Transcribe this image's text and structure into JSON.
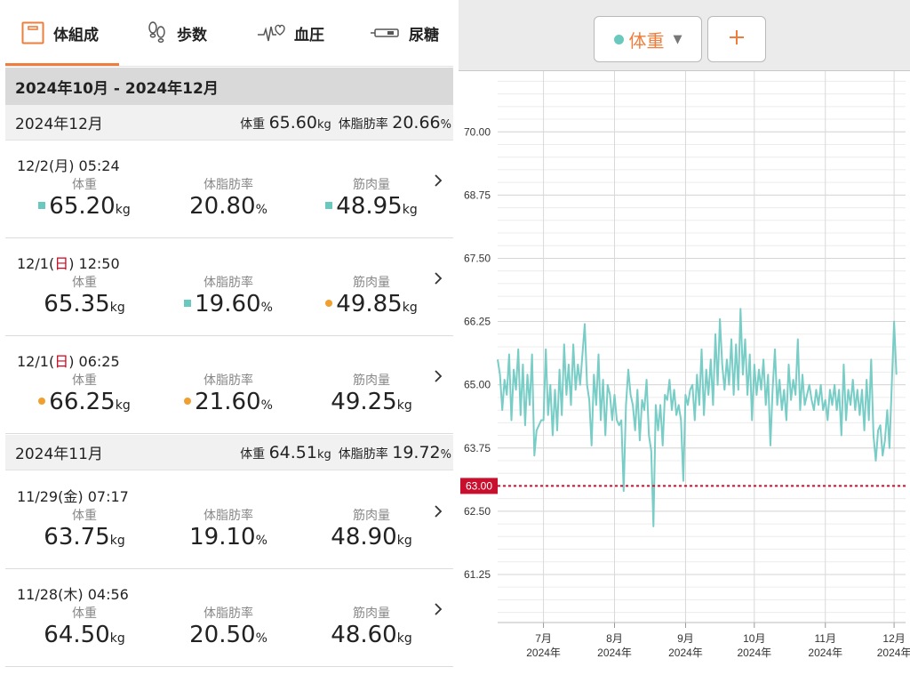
{
  "tabs": [
    {
      "label": "体組成",
      "icon": "body-composition-icon",
      "active": true
    },
    {
      "label": "歩数",
      "icon": "footsteps-icon",
      "active": false
    },
    {
      "label": "血圧",
      "icon": "heart-pulse-icon",
      "active": false
    },
    {
      "label": "尿糖",
      "icon": "urine-glucose-icon",
      "active": false
    }
  ],
  "range_label": "2024年10月 - 2024年12月",
  "months": [
    {
      "name": "2024年12月",
      "weight_label": "体重",
      "weight": "65.60",
      "weight_unit": "kg",
      "fat_label": "体脂肪率",
      "fat": "20.66",
      "fat_unit": "%"
    },
    {
      "name": "2024年11月",
      "weight_label": "体重",
      "weight": "64.51",
      "weight_unit": "kg",
      "fat_label": "体脂肪率",
      "fat": "19.72",
      "fat_unit": "%"
    }
  ],
  "entries": [
    {
      "date": "12/2",
      "weekday": "月",
      "is_sunday": false,
      "time": "05:24",
      "weight": "65.20",
      "weight_marker": "square",
      "fat": "20.80",
      "fat_marker": "none",
      "muscle": "48.95",
      "muscle_marker": "square"
    },
    {
      "date": "12/1",
      "weekday": "日",
      "is_sunday": true,
      "time": "12:50",
      "weight": "65.35",
      "weight_marker": "none",
      "fat": "19.60",
      "fat_marker": "square",
      "muscle": "49.85",
      "muscle_marker": "dot"
    },
    {
      "date": "12/1",
      "weekday": "日",
      "is_sunday": true,
      "time": "06:25",
      "weight": "66.25",
      "weight_marker": "dot",
      "fat": "21.60",
      "fat_marker": "dot",
      "muscle": "49.25",
      "muscle_marker": "none"
    },
    {
      "date": "11/29",
      "weekday": "金",
      "is_sunday": false,
      "time": "07:17",
      "weight": "63.75",
      "weight_marker": "none",
      "fat": "19.10",
      "fat_marker": "none",
      "muscle": "48.90",
      "muscle_marker": "none"
    },
    {
      "date": "11/28",
      "weekday": "木",
      "is_sunday": false,
      "time": "04:56",
      "weight": "64.50",
      "weight_marker": "none",
      "fat": "20.50",
      "fat_marker": "none",
      "muscle": "48.60",
      "muscle_marker": "none"
    }
  ],
  "labels": {
    "weight": "体重",
    "fat": "体脂肪率",
    "muscle": "筋肉量",
    "kg": "kg",
    "pct": "%"
  },
  "colors": {
    "accent": "#ef7d3c",
    "series": "#78cdc6",
    "target_line": "#c8102e",
    "sunday": "#d0021b",
    "marker_square": "#6ac9be",
    "marker_dot": "#f0a030"
  },
  "chart_selector": {
    "label": "体重",
    "caret": "▼",
    "add_icon": "plus-icon"
  },
  "chart_data": {
    "type": "line",
    "ylabel": "",
    "ylim": [
      60.3,
      71.2
    ],
    "yticks": [
      "70.00",
      "68.75",
      "67.50",
      "66.25",
      "65.00",
      "63.75",
      "62.50",
      "61.25"
    ],
    "target": {
      "value": 63.0,
      "label": "63.00"
    },
    "xticks": [
      {
        "month": "7月",
        "year": "2024年",
        "x": "2024-07-01"
      },
      {
        "month": "8月",
        "year": "2024年",
        "x": "2024-08-01"
      },
      {
        "month": "9月",
        "year": "2024年",
        "x": "2024-09-01"
      },
      {
        "month": "10月",
        "year": "2024年",
        "x": "2024-10-01"
      },
      {
        "month": "11月",
        "year": "2024年",
        "x": "2024-11-01"
      },
      {
        "month": "12月",
        "year": "2024年",
        "x": "2024-12-01"
      }
    ],
    "xlim": [
      "2024-06-11",
      "2024-12-06"
    ],
    "grid": true,
    "series": [
      {
        "name": "体重",
        "points": [
          [
            "2024-06-11",
            65.5
          ],
          [
            "2024-06-12",
            65.2
          ],
          [
            "2024-06-13",
            64.5
          ],
          [
            "2024-06-14",
            65.1
          ],
          [
            "2024-06-15",
            64.8
          ],
          [
            "2024-06-16",
            65.6
          ],
          [
            "2024-06-17",
            64.3
          ],
          [
            "2024-06-18",
            65.3
          ],
          [
            "2024-06-19",
            64.9
          ],
          [
            "2024-06-20",
            65.7
          ],
          [
            "2024-06-21",
            64.4
          ],
          [
            "2024-06-22",
            65.4
          ],
          [
            "2024-06-23",
            64.2
          ],
          [
            "2024-06-24",
            65.2
          ],
          [
            "2024-06-25",
            64.6
          ],
          [
            "2024-06-26",
            65.6
          ],
          [
            "2024-06-27",
            63.6
          ],
          [
            "2024-06-28",
            64.1
          ],
          [
            "2024-06-29",
            64.2
          ],
          [
            "2024-06-30",
            64.3
          ],
          [
            "2024-07-01",
            64.3
          ],
          [
            "2024-07-02",
            65.7
          ],
          [
            "2024-07-03",
            64.4
          ],
          [
            "2024-07-04",
            65.0
          ],
          [
            "2024-07-05",
            64.0
          ],
          [
            "2024-07-06",
            64.9
          ],
          [
            "2024-07-07",
            64.1
          ],
          [
            "2024-07-08",
            65.3
          ],
          [
            "2024-07-09",
            64.4
          ],
          [
            "2024-07-10",
            65.8
          ],
          [
            "2024-07-11",
            64.8
          ],
          [
            "2024-07-12",
            65.4
          ],
          [
            "2024-07-13",
            64.6
          ],
          [
            "2024-07-14",
            65.8
          ],
          [
            "2024-07-15",
            64.9
          ],
          [
            "2024-07-16",
            65.4
          ],
          [
            "2024-07-17",
            65.0
          ],
          [
            "2024-07-18",
            65.6
          ],
          [
            "2024-07-19",
            66.2
          ],
          [
            "2024-07-20",
            65.0
          ],
          [
            "2024-07-21",
            64.7
          ],
          [
            "2024-07-22",
            63.8
          ],
          [
            "2024-07-23",
            65.2
          ],
          [
            "2024-07-24",
            64.6
          ],
          [
            "2024-07-25",
            65.6
          ],
          [
            "2024-07-26",
            64.3
          ],
          [
            "2024-07-27",
            65.1
          ],
          [
            "2024-07-28",
            64.0
          ],
          [
            "2024-07-29",
            65.0
          ],
          [
            "2024-07-30",
            64.8
          ],
          [
            "2024-07-31",
            64.3
          ],
          [
            "2024-08-01",
            64.8
          ],
          [
            "2024-08-02",
            64.3
          ],
          [
            "2024-08-03",
            64.2
          ],
          [
            "2024-08-04",
            64.3
          ],
          [
            "2024-08-05",
            62.9
          ],
          [
            "2024-08-06",
            64.6
          ],
          [
            "2024-08-07",
            65.3
          ],
          [
            "2024-08-08",
            64.8
          ],
          [
            "2024-08-09",
            64.6
          ],
          [
            "2024-08-10",
            64.1
          ],
          [
            "2024-08-11",
            64.9
          ],
          [
            "2024-08-12",
            63.9
          ],
          [
            "2024-08-13",
            64.7
          ],
          [
            "2024-08-14",
            64.5
          ],
          [
            "2024-08-15",
            65.1
          ],
          [
            "2024-08-16",
            64.0
          ],
          [
            "2024-08-17",
            63.7
          ],
          [
            "2024-08-18",
            62.2
          ],
          [
            "2024-08-19",
            64.6
          ],
          [
            "2024-08-20",
            64.1
          ],
          [
            "2024-08-21",
            64.6
          ],
          [
            "2024-08-22",
            63.8
          ],
          [
            "2024-08-23",
            64.8
          ],
          [
            "2024-08-24",
            64.7
          ],
          [
            "2024-08-25",
            65.1
          ],
          [
            "2024-08-26",
            64.5
          ],
          [
            "2024-08-27",
            64.9
          ],
          [
            "2024-08-28",
            64.4
          ],
          [
            "2024-08-29",
            64.6
          ],
          [
            "2024-08-30",
            64.3
          ],
          [
            "2024-08-31",
            63.1
          ],
          [
            "2024-09-01",
            64.8
          ],
          [
            "2024-09-02",
            64.6
          ],
          [
            "2024-09-03",
            64.9
          ],
          [
            "2024-09-04",
            65.0
          ],
          [
            "2024-09-05",
            64.3
          ],
          [
            "2024-09-06",
            65.2
          ],
          [
            "2024-09-07",
            64.6
          ],
          [
            "2024-09-08",
            65.7
          ],
          [
            "2024-09-09",
            64.4
          ],
          [
            "2024-09-10",
            65.3
          ],
          [
            "2024-09-11",
            64.8
          ],
          [
            "2024-09-12",
            65.5
          ],
          [
            "2024-09-13",
            64.6
          ],
          [
            "2024-09-14",
            66.0
          ],
          [
            "2024-09-15",
            65.0
          ],
          [
            "2024-09-16",
            66.3
          ],
          [
            "2024-09-17",
            65.4
          ],
          [
            "2024-09-18",
            64.9
          ],
          [
            "2024-09-19",
            65.5
          ],
          [
            "2024-09-20",
            65.0
          ],
          [
            "2024-09-21",
            65.9
          ],
          [
            "2024-09-22",
            64.8
          ],
          [
            "2024-09-23",
            65.8
          ],
          [
            "2024-09-24",
            64.9
          ],
          [
            "2024-09-25",
            66.5
          ],
          [
            "2024-09-26",
            65.2
          ],
          [
            "2024-09-27",
            65.9
          ],
          [
            "2024-09-28",
            64.8
          ],
          [
            "2024-09-29",
            65.6
          ],
          [
            "2024-09-30",
            64.3
          ],
          [
            "2024-10-01",
            65.4
          ],
          [
            "2024-10-02",
            64.8
          ],
          [
            "2024-10-03",
            65.3
          ],
          [
            "2024-10-04",
            64.9
          ],
          [
            "2024-10-05",
            65.5
          ],
          [
            "2024-10-06",
            64.6
          ],
          [
            "2024-10-07",
            65.2
          ],
          [
            "2024-10-08",
            63.8
          ],
          [
            "2024-10-09",
            64.9
          ],
          [
            "2024-10-10",
            65.7
          ],
          [
            "2024-10-11",
            64.6
          ],
          [
            "2024-10-12",
            65.1
          ],
          [
            "2024-10-13",
            64.5
          ],
          [
            "2024-10-14",
            64.9
          ],
          [
            "2024-10-15",
            64.3
          ],
          [
            "2024-10-16",
            65.4
          ],
          [
            "2024-10-17",
            64.7
          ],
          [
            "2024-10-18",
            65.1
          ],
          [
            "2024-10-19",
            64.8
          ],
          [
            "2024-10-20",
            65.9
          ],
          [
            "2024-10-21",
            64.5
          ],
          [
            "2024-10-22",
            65.2
          ],
          [
            "2024-10-23",
            64.6
          ],
          [
            "2024-10-24",
            64.8
          ],
          [
            "2024-10-25",
            65.0
          ],
          [
            "2024-10-26",
            64.7
          ],
          [
            "2024-10-27",
            64.5
          ],
          [
            "2024-10-28",
            64.9
          ],
          [
            "2024-10-29",
            64.6
          ],
          [
            "2024-10-30",
            65.0
          ],
          [
            "2024-10-31",
            64.5
          ],
          [
            "2024-11-01",
            64.7
          ],
          [
            "2024-11-02",
            64.3
          ],
          [
            "2024-11-03",
            64.9
          ],
          [
            "2024-11-04",
            64.6
          ],
          [
            "2024-11-05",
            65.0
          ],
          [
            "2024-11-06",
            64.5
          ],
          [
            "2024-11-07",
            64.9
          ],
          [
            "2024-11-08",
            64.0
          ],
          [
            "2024-11-09",
            65.4
          ],
          [
            "2024-11-10",
            64.3
          ],
          [
            "2024-11-11",
            64.9
          ],
          [
            "2024-11-12",
            64.6
          ],
          [
            "2024-11-13",
            65.1
          ],
          [
            "2024-11-14",
            64.5
          ],
          [
            "2024-11-15",
            64.9
          ],
          [
            "2024-11-16",
            64.4
          ],
          [
            "2024-11-17",
            64.9
          ],
          [
            "2024-11-18",
            64.1
          ],
          [
            "2024-11-19",
            65.1
          ],
          [
            "2024-11-20",
            64.3
          ],
          [
            "2024-11-21",
            65.5
          ],
          [
            "2024-11-22",
            64.0
          ],
          [
            "2024-11-23",
            63.5
          ],
          [
            "2024-11-24",
            64.1
          ],
          [
            "2024-11-25",
            64.2
          ],
          [
            "2024-11-26",
            63.6
          ],
          [
            "2024-11-27",
            63.9
          ],
          [
            "2024-11-28",
            64.5
          ],
          [
            "2024-11-29",
            63.75
          ],
          [
            "2024-11-30",
            65.0
          ],
          [
            "2024-12-01",
            66.25
          ],
          [
            "2024-12-02",
            65.2
          ]
        ]
      }
    ]
  }
}
